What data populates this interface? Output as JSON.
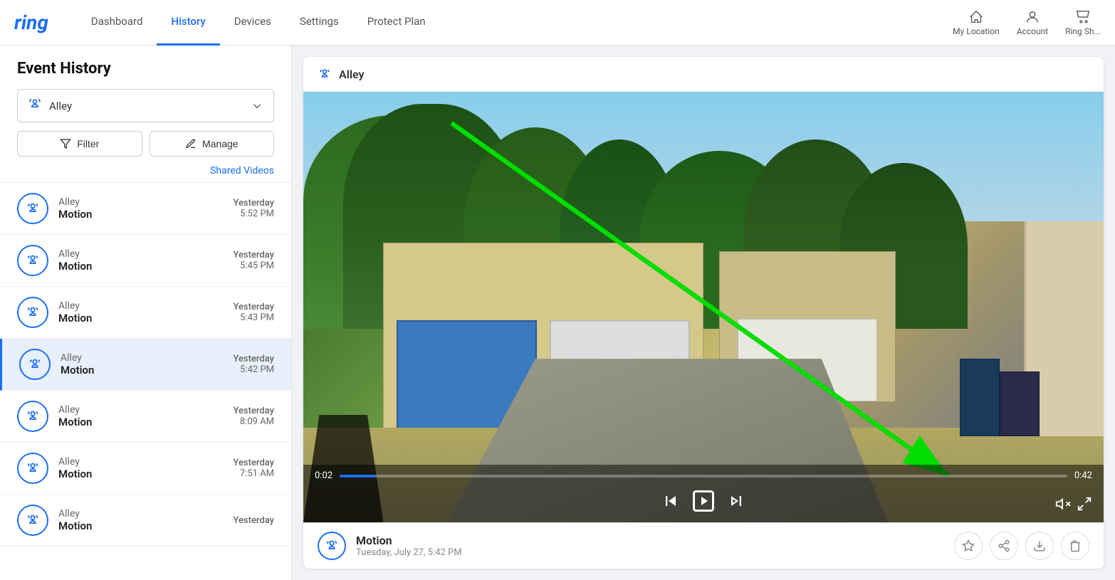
{
  "app": {
    "logo": "ring"
  },
  "nav": {
    "links": [
      {
        "label": "Dashboard",
        "active": false
      },
      {
        "label": "History",
        "active": true
      },
      {
        "label": "Devices",
        "active": false
      },
      {
        "label": "Settings",
        "active": false
      },
      {
        "label": "Protect Plan",
        "active": false
      }
    ],
    "right_items": [
      {
        "label": "My Location",
        "icon": "home-icon"
      },
      {
        "label": "Account",
        "icon": "account-icon"
      },
      {
        "label": "Ring Sh...",
        "icon": "shop-icon"
      }
    ]
  },
  "sidebar": {
    "title": "Event History",
    "device_selector": {
      "name": "Alley",
      "icon": "motion-icon"
    },
    "filter_btn": "Filter",
    "manage_btn": "Manage",
    "shared_videos": "Shared Videos",
    "events": [
      {
        "name": "Alley",
        "type": "Motion",
        "day": "Yesterday",
        "time": "5:52 PM",
        "active": false
      },
      {
        "name": "Alley",
        "type": "Motion",
        "day": "Yesterday",
        "time": "5:45 PM",
        "active": false
      },
      {
        "name": "Alley",
        "type": "Motion",
        "day": "Yesterday",
        "time": "5:43 PM",
        "active": false
      },
      {
        "name": "Alley",
        "type": "Motion",
        "day": "Yesterday",
        "time": "5:42 PM",
        "active": true
      },
      {
        "name": "Alley",
        "type": "Motion",
        "day": "Yesterday",
        "time": "8:09 AM",
        "active": false
      },
      {
        "name": "Alley",
        "type": "Motion",
        "day": "Yesterday",
        "time": "7:51 AM",
        "active": false
      },
      {
        "name": "Alley",
        "type": "Motion",
        "day": "Yesterday",
        "time": "",
        "active": false
      }
    ]
  },
  "video_panel": {
    "device_name": "Alley",
    "current_time": "0:02",
    "total_time": "0:42",
    "progress_percent": 5,
    "event_type": "Motion",
    "event_date": "Tuesday, July 27, 5:42 PM"
  }
}
